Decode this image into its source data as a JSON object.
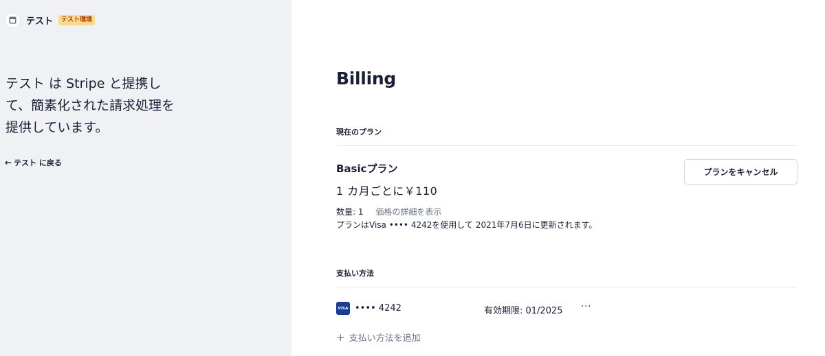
{
  "merchant": {
    "name": "テスト",
    "env_badge": "テスト環境",
    "icon": "store-icon"
  },
  "sidebar": {
    "tagline": "テスト は Stripe と提携して、簡素化された請求処理を提供しています。",
    "back_arrow": "←",
    "back_link": "テスト に戻る"
  },
  "billing": {
    "title": "Billing",
    "current_plan": {
      "section_label": "現在のプラン",
      "plan_name": "Basicプラン",
      "price": "1 カ月ごとに￥110",
      "quantity": "数量: 1",
      "details_link": "価格の詳細を表示",
      "renewal": "プランはVisa •••• 4242を使用して 2021年7月6日に更新されます。",
      "cancel_button": "プランをキャンセル"
    },
    "payment_methods": {
      "section_label": "支払い方法",
      "cards": [
        {
          "brand": "VISA",
          "number": "•••• 4242",
          "expiry": "有効期限: 01/2025",
          "menu": "···"
        }
      ],
      "add_plus": "+",
      "add_label": "支払い方法を追加"
    }
  },
  "colors": {
    "sidebar_bg": "#f0f1f4",
    "badge_bg": "#fcd98f",
    "badge_text": "#a04100",
    "visa_blue": "#1a3d96",
    "muted_text": "#687385"
  }
}
